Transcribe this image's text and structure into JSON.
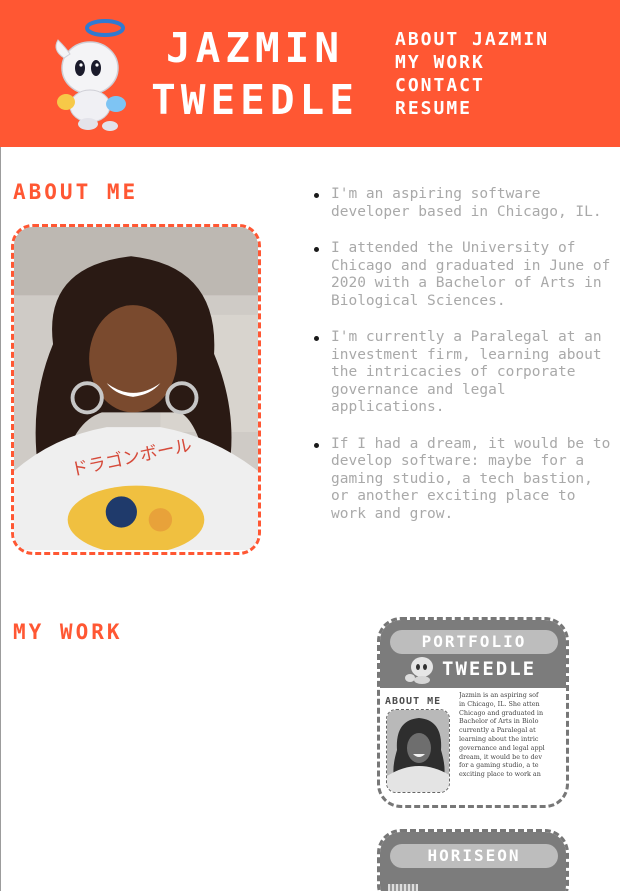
{
  "header": {
    "name_line1": "JAZMIN",
    "name_line2": "TWEEDLE",
    "nav": [
      {
        "label": "ABOUT JAZMIN"
      },
      {
        "label": "MY WORK"
      },
      {
        "label": "CONTACT"
      },
      {
        "label": "RESUME"
      }
    ]
  },
  "about": {
    "title": "ABOUT ME",
    "bio": [
      "I'm an aspiring software developer based in Chicago, IL.",
      "I attended the University of Chicago and graduated in June of 2020 with a Bachelor of Arts in Biological Sciences.",
      "I'm currently a Paralegal at an investment firm, learning about the intricacies of corporate governance and legal applications.",
      "If I had a dream, it would be to develop software: maybe for a gaming studio, a tech bastion, or another exciting place to work and grow."
    ]
  },
  "work": {
    "title": "MY WORK",
    "projects": [
      {
        "label": "PORTFOLIO",
        "preview": {
          "name": "TWEEDLE",
          "section": "ABOUT ME",
          "lines": [
            "Jazmin is an aspiring sof",
            "in Chicago, IL. She atten",
            "Chicago and graduated in",
            "Bachelor of Arts in Biolo",
            "currently a Paralegal at",
            "learning about the intric",
            "governance and legal appl",
            "dream, it would be to dev",
            "for a gaming studio, a te",
            "exciting place to work an"
          ]
        }
      },
      {
        "label": "HORISEON"
      }
    ]
  },
  "colors": {
    "accent": "#ff5733",
    "body_text": "#a9a9a9",
    "card_gray": "#7c7c7c",
    "white": "#ffffff"
  }
}
